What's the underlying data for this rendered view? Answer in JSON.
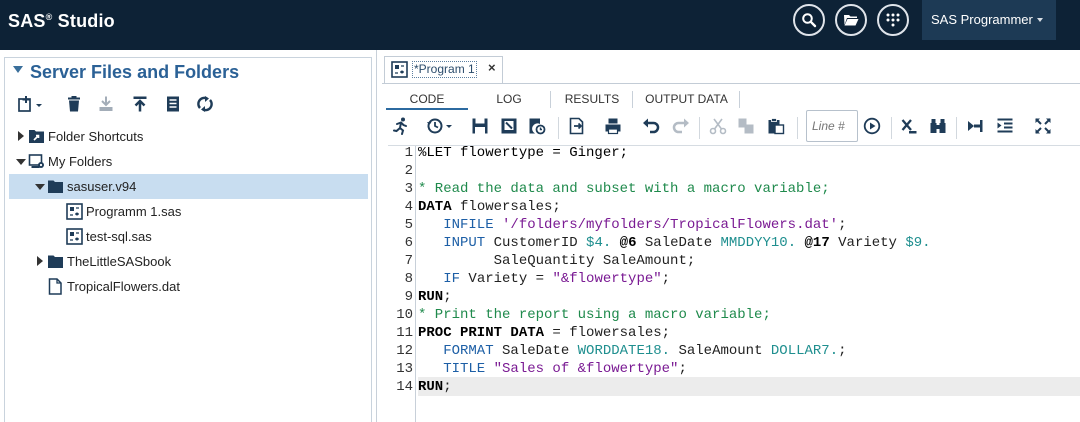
{
  "app": {
    "title": "SAS",
    "title_suffix": "Studio",
    "trademark": "®"
  },
  "topbar": {
    "perspective": "SAS Programmer"
  },
  "left_pane": {
    "title": "Server Files and Folders",
    "tree": [
      {
        "label": "Folder Shortcuts",
        "expanded": false,
        "depth": 0,
        "icon": "folder-shortcuts-icon"
      },
      {
        "label": "My Folders",
        "expanded": true,
        "depth": 0,
        "icon": "my-folders-icon"
      },
      {
        "label": "sasuser.v94",
        "expanded": true,
        "depth": 1,
        "icon": "folder-icon",
        "selected": true
      },
      {
        "label": "Programm 1.sas",
        "depth": 2,
        "icon": "sas-program-icon"
      },
      {
        "label": "test-sql.sas",
        "depth": 2,
        "icon": "sas-program-icon"
      },
      {
        "label": "TheLittleSASbook",
        "expanded": false,
        "depth": 1,
        "icon": "folder-icon"
      },
      {
        "label": "TropicalFlowers.dat",
        "depth": 1,
        "icon": "file-icon"
      }
    ]
  },
  "program_tab": {
    "label": "*Program 1",
    "close": "×"
  },
  "subtabs": [
    "CODE",
    "LOG",
    "RESULTS",
    "OUTPUT DATA"
  ],
  "toolbar": {
    "line_placeholder": "Line #"
  },
  "editor": {
    "line_numbers": [
      "1",
      "2",
      "3",
      "4",
      "5",
      "6",
      "7",
      "8",
      "9",
      "10",
      "11",
      "12",
      "13",
      "14"
    ],
    "code": [
      {
        "t": "%LET flowertype = Ginger;"
      },
      {
        "t": ""
      },
      {
        "t": "* Read the data and subset with a macro variable;"
      },
      {
        "a": "DATA",
        "b": " flowersales;"
      },
      {
        "a": "   INFILE",
        "b": " ",
        "c": "'/folders/myfolders/TropicalFlowers.dat'",
        "d": ";"
      },
      {
        "a": "   INPUT",
        "b": " CustomerID ",
        "c": "$4.",
        "d": " ",
        "e": "@6",
        "f": " SaleDate ",
        "g": "MMDDYY10.",
        "h": " ",
        "i": "@17",
        "j": " Variety ",
        "k": "$9."
      },
      {
        "t": "         SaleQuantity SaleAmount;"
      },
      {
        "a": "   IF",
        "b": " Variety = ",
        "c": "\"&flowertype\"",
        "d": ";"
      },
      {
        "a": "RUN",
        "b": ";"
      },
      {
        "t": "* Print the report using a macro variable;"
      },
      {
        "a": "PROC PRINT DATA",
        "b": " = flowersales;"
      },
      {
        "a": "   FORMAT",
        "b": " SaleDate ",
        "c": "WORDDATE18.",
        "d": " SaleAmount ",
        "e": "DOLLAR7.",
        "f": ";"
      },
      {
        "a": "   TITLE",
        "b": " ",
        "c": "\"Sales of &flowertype\"",
        "d": ";"
      },
      {
        "a": "RUN",
        "b": ";"
      }
    ]
  }
}
